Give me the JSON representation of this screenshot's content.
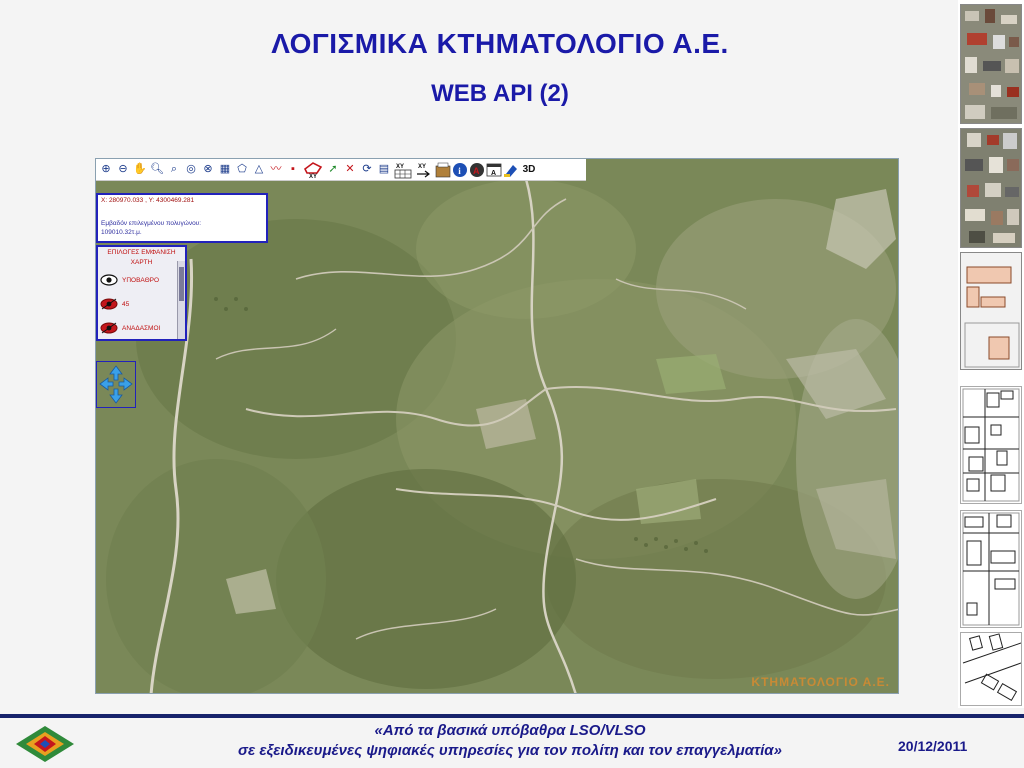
{
  "slide": {
    "title": "ΛΟΓΙΣΜΙΚΑ ΚΤΗΜΑΤΟΛΟΓΙΟ Α.Ε.",
    "subtitle": "WEB API (2)"
  },
  "map": {
    "toolbar": {
      "tools": [
        {
          "name": "zoom-in-tool",
          "icon": "plus-circle-icon"
        },
        {
          "name": "zoom-out-tool",
          "icon": "minus-circle-icon"
        },
        {
          "name": "pan-tool",
          "icon": "hand-icon"
        },
        {
          "name": "zoom-box-in-tool",
          "icon": "magnifier-plus-icon"
        },
        {
          "name": "zoom-box-out-tool",
          "icon": "magnifier-minus-icon"
        },
        {
          "name": "zoom-extent-tool",
          "icon": "magnifier-globe-icon"
        },
        {
          "name": "full-extent-tool",
          "icon": "globe-icon"
        },
        {
          "name": "layers-tool",
          "icon": "layers-icon"
        },
        {
          "name": "measure-area-tool",
          "icon": "polygon-icon"
        },
        {
          "name": "draw-polygon-tool",
          "icon": "triangle-icon"
        },
        {
          "name": "draw-line-tool",
          "icon": "polyline-icon"
        },
        {
          "name": "draw-point-tool",
          "icon": "dot-icon"
        },
        {
          "name": "xy-polygon-tool",
          "icon": "red-polygon-xy-icon"
        },
        {
          "name": "select-tool",
          "icon": "arrow-select-icon"
        },
        {
          "name": "clear-tool",
          "icon": "red-x-icon"
        },
        {
          "name": "refresh-tool",
          "icon": "refresh-icon"
        },
        {
          "name": "report-tool",
          "icon": "document-icon"
        },
        {
          "name": "xy-table-tool",
          "icon": "xy-table-icon"
        },
        {
          "name": "xy-goto-tool",
          "icon": "xy-arrow-icon"
        },
        {
          "name": "kaek-tool",
          "icon": "kaek-icon"
        },
        {
          "name": "info-tool",
          "icon": "info-icon"
        },
        {
          "name": "annotation-tool",
          "icon": "annotation-icon"
        },
        {
          "name": "text-label-tool",
          "icon": "text-label-icon"
        },
        {
          "name": "highlight-tool",
          "icon": "highlight-icon"
        },
        {
          "name": "view-3d-tool",
          "icon": "3d-icon"
        }
      ],
      "xy_label": "XY",
      "xy2_label": "XY",
      "label_3d": "3D"
    },
    "info": {
      "coords": "X: 280970.033 , Y: 4300469.281",
      "area_label": "Εμβαδόν επιλεγμένου πολυγώνου:",
      "area_value": "109010.32τ.μ."
    },
    "layers": {
      "title_line1": "ΕΠΙΛΟΓΕΣ ΕΜΦΑΝΙΣΗ",
      "title_line2": "ΧΑΡΤΗ",
      "items": [
        {
          "label": "ΥΠΟΒΑΘΡΟ",
          "icon": "eye-visible-icon"
        },
        {
          "label": "45",
          "icon": "eye-hidden-icon"
        },
        {
          "label": "ΑΝΑΔΑΣΜΟΙ",
          "icon": "eye-hidden-icon"
        }
      ]
    },
    "pan_control_icon": "pan-arrows-icon",
    "watermark": "ΚΤΗΜΑΤΟΛΟΓΙΟ Α.Ε."
  },
  "footer": {
    "line1": "«Από τα βασικά υπόβαθρα LSO/VLSO",
    "line2": "σε εξειδικευμένες ψηφιακές υπηρεσίες για τον πολίτη και τον επαγγελματία»",
    "date": "20/12/2011",
    "logo_icon": "company-logo-icon"
  },
  "colors": {
    "title": "#1a1aa8",
    "panel_border": "#2222bb",
    "footer_bar": "#17236b",
    "map_base": "#7c8a5a"
  }
}
